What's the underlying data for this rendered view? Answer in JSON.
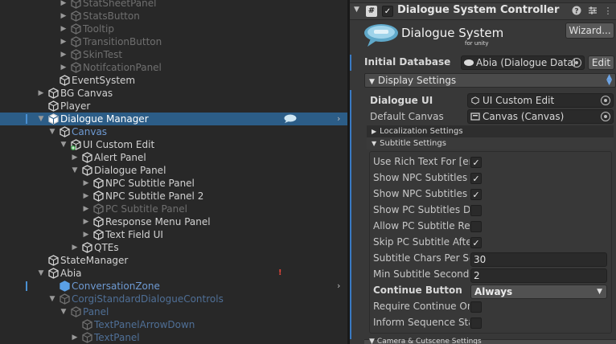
{
  "hierarchy": {
    "rows": [
      {
        "label": "StatSheetPanel",
        "depth": 3,
        "expand": "right",
        "style": "dim",
        "icon": "cube-icon"
      },
      {
        "label": "StatsButton",
        "depth": 3,
        "expand": "right",
        "style": "dim",
        "icon": "cube-icon"
      },
      {
        "label": "Tooltip",
        "depth": 3,
        "expand": "right",
        "style": "dim",
        "icon": "cube-icon"
      },
      {
        "label": "TransitionButton",
        "depth": 3,
        "expand": "right",
        "style": "dim",
        "icon": "cube-icon"
      },
      {
        "label": "SkinTest",
        "depth": 3,
        "expand": "right",
        "style": "dim",
        "icon": "cube-icon"
      },
      {
        "label": "NotifcationPanel",
        "depth": 3,
        "expand": "right",
        "style": "dim",
        "icon": "cube-icon"
      },
      {
        "label": "EventSystem",
        "depth": 2,
        "expand": "none",
        "style": "normal",
        "icon": "cube-icon"
      },
      {
        "label": "BG Canvas",
        "depth": 1,
        "expand": "right",
        "style": "normal",
        "icon": "cube-icon"
      },
      {
        "label": "Player",
        "depth": 1,
        "expand": "none",
        "style": "normal",
        "icon": "cube-icon"
      },
      {
        "label": "Dialogue Manager",
        "depth": 1,
        "expand": "down",
        "style": "selected",
        "icon": "cube-icon",
        "has_cloud": true,
        "has_chevron": true
      },
      {
        "label": "Canvas",
        "depth": 2,
        "expand": "down",
        "style": "blue",
        "icon": "cube-icon"
      },
      {
        "label": "UI Custom Edit",
        "depth": 3,
        "expand": "down",
        "style": "normal",
        "icon": "cube-plus-icon"
      },
      {
        "label": "Alert Panel",
        "depth": 4,
        "expand": "right",
        "style": "normal",
        "icon": "cube-icon"
      },
      {
        "label": "Dialogue Panel",
        "depth": 4,
        "expand": "down",
        "style": "normal",
        "icon": "cube-icon"
      },
      {
        "label": "NPC Subtitle Panel",
        "depth": 5,
        "expand": "right",
        "style": "normal",
        "icon": "cube-icon"
      },
      {
        "label": "NPC Subtitle Panel 2",
        "depth": 5,
        "expand": "right",
        "style": "normal",
        "icon": "cube-icon"
      },
      {
        "label": "PC Subtitle Panel",
        "depth": 5,
        "expand": "right",
        "style": "dim",
        "icon": "cube-icon"
      },
      {
        "label": "Response Menu Panel",
        "depth": 5,
        "expand": "right",
        "style": "normal",
        "icon": "cube-icon"
      },
      {
        "label": "Text Field UI",
        "depth": 5,
        "expand": "right",
        "style": "normal",
        "icon": "cube-icon"
      },
      {
        "label": "QTEs",
        "depth": 4,
        "expand": "right",
        "style": "normal",
        "icon": "cube-icon"
      },
      {
        "label": "StateManager",
        "depth": 1,
        "expand": "none",
        "style": "normal",
        "icon": "cube-icon"
      },
      {
        "label": "Abia",
        "depth": 1,
        "expand": "down",
        "style": "normal",
        "icon": "cube-icon",
        "has_warning": true
      },
      {
        "label": "ConversationZone",
        "depth": 2,
        "expand": "none",
        "style": "blue",
        "icon": "cube-blue-icon",
        "has_chevron": true,
        "has_marker": true
      },
      {
        "label": "CorgiStandardDialogueControls",
        "depth": 2,
        "expand": "down",
        "style": "dimblue",
        "icon": "cube-icon"
      },
      {
        "label": "Panel",
        "depth": 3,
        "expand": "down",
        "style": "dimblue",
        "icon": "cube-icon"
      },
      {
        "label": "TextPanelArrowDown",
        "depth": 4,
        "expand": "none",
        "style": "dimblue",
        "icon": "cube-icon"
      },
      {
        "label": "TextPanel",
        "depth": 4,
        "expand": "right",
        "style": "dimblue",
        "icon": "cube-icon"
      }
    ]
  },
  "inspector": {
    "component_title": "Dialogue System Controller",
    "logo_title": "Dialogue System",
    "logo_subtitle": "for unity",
    "wizard_label": "Wizard...",
    "initial_database_label": "Initial Database",
    "initial_database_value": "Abia (Dialogue Datal",
    "edit_label": "Edit",
    "display_settings_label": "Display Settings",
    "dialogue_ui_label": "Dialogue UI",
    "dialogue_ui_value": "UI Custom Edit",
    "default_canvas_label": "Default Canvas",
    "default_canvas_value": "Canvas (Canvas)",
    "localization_label": "Localization Settings",
    "subtitle_settings_label": "Subtitle Settings",
    "settings": [
      {
        "label": "Use Rich Text For [en",
        "type": "checkbox",
        "checked": true
      },
      {
        "label": "Show NPC Subtitles I",
        "type": "checkbox",
        "checked": true
      },
      {
        "label": "Show NPC Subtitles V",
        "type": "checkbox",
        "checked": true
      },
      {
        "label": "Show PC Subtitles Du",
        "type": "checkbox",
        "checked": false
      },
      {
        "label": "Allow PC Subtitle Rer",
        "type": "checkbox",
        "checked": false
      },
      {
        "label": "Skip PC Subtitle Afte",
        "type": "checkbox",
        "checked": true
      },
      {
        "label": "Subtitle Chars Per Se",
        "type": "number",
        "value": "30"
      },
      {
        "label": "Min Subtitle Seconds",
        "type": "number",
        "value": "2"
      },
      {
        "label": "Continue Button",
        "type": "dropdown",
        "value": "Always",
        "bold": true
      },
      {
        "label": "Require Continue On",
        "type": "checkbox",
        "checked": false
      },
      {
        "label": "Inform Sequence Sta",
        "type": "checkbox",
        "checked": false
      }
    ],
    "bottom_fold_label": "Camera & Cutscene Settings"
  },
  "colors": {
    "selection": "#2c5d87",
    "accent_blue": "#6e9ad3",
    "warning": "#e0453a",
    "logo_cloud": "#5fa8c9"
  }
}
